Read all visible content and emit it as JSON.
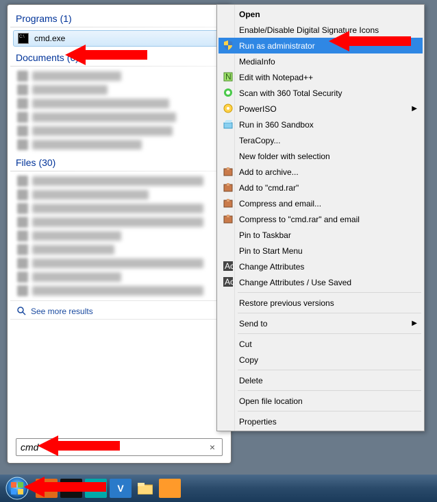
{
  "start_menu": {
    "programs_header": "Programs (1)",
    "program_item": "cmd.exe",
    "documents_header": "Documents (6)",
    "files_header": "Files (30)",
    "see_more": "See more results",
    "search_value": "cmd"
  },
  "context_menu": {
    "open": "Open",
    "enable_disable_sigs": "Enable/Disable Digital Signature Icons",
    "run_as_admin": "Run as administrator",
    "mediainfo": "MediaInfo",
    "edit_notepadpp": "Edit with Notepad++",
    "scan_360": "Scan with 360 Total Security",
    "poweriso": "PowerISO",
    "run_sandbox": "Run in 360 Sandbox",
    "teracopy": "TeraCopy...",
    "new_folder_sel": "New folder with selection",
    "add_archive": "Add to archive...",
    "add_cmd_rar": "Add to \"cmd.rar\"",
    "compress_email": "Compress and email...",
    "compress_cmd_email": "Compress to \"cmd.rar\" and email",
    "pin_taskbar": "Pin to Taskbar",
    "pin_startmenu": "Pin to Start Menu",
    "change_attrs": "Change Attributes",
    "change_attrs_saved": "Change Attributes / Use Saved",
    "restore_versions": "Restore previous versions",
    "send_to": "Send to",
    "cut": "Cut",
    "copy": "Copy",
    "delete": "Delete",
    "open_file_loc": "Open file location",
    "properties": "Properties"
  }
}
